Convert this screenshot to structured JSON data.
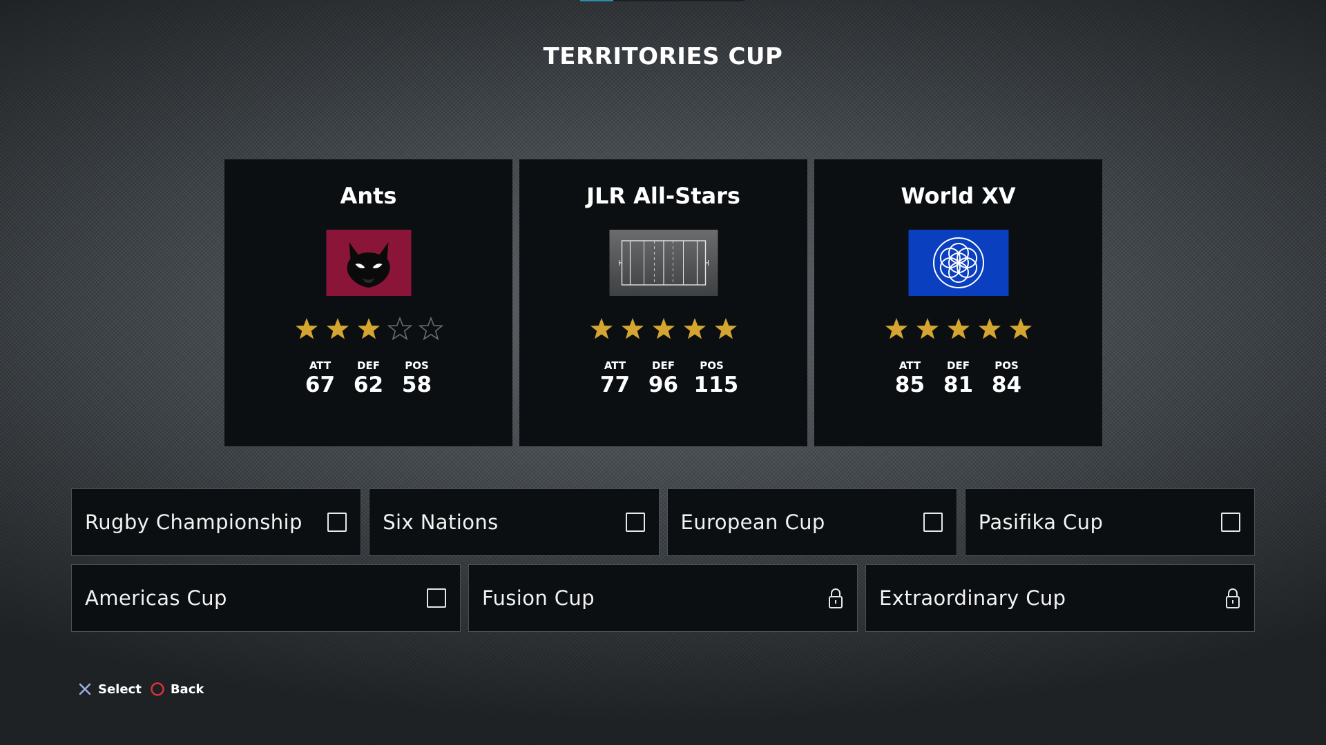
{
  "title": "TERRITORIES CUP",
  "colors": {
    "star_filled": "#d4a530",
    "star_empty": "#6b6f73",
    "card_bg": "#0b0f12",
    "accent": "#2a8fb0"
  },
  "teams": [
    {
      "name": "Ants",
      "badge_icon": "ant-head-icon",
      "badge_color": "#8b1538",
      "rating": 3,
      "max_rating": 5,
      "stats": [
        {
          "label": "ATT",
          "value": "67"
        },
        {
          "label": "DEF",
          "value": "62"
        },
        {
          "label": "POS",
          "value": "58"
        }
      ]
    },
    {
      "name": "JLR All-Stars",
      "badge_icon": "rugby-pitch-icon",
      "badge_color": "#4a4c4e",
      "rating": 5,
      "max_rating": 5,
      "stats": [
        {
          "label": "ATT",
          "value": "77"
        },
        {
          "label": "DEF",
          "value": "96"
        },
        {
          "label": "POS",
          "value": "115"
        }
      ]
    },
    {
      "name": "World XV",
      "badge_icon": "flower-of-life-icon",
      "badge_color": "#0a3fc0",
      "rating": 5,
      "max_rating": 5,
      "stats": [
        {
          "label": "ATT",
          "value": "85"
        },
        {
          "label": "DEF",
          "value": "81"
        },
        {
          "label": "POS",
          "value": "84"
        }
      ]
    }
  ],
  "competitions": [
    {
      "label": "Rugby Championship",
      "state": "unchecked"
    },
    {
      "label": "Six Nations",
      "state": "unchecked"
    },
    {
      "label": "European Cup",
      "state": "unchecked"
    },
    {
      "label": "Pasifika Cup",
      "state": "unchecked"
    },
    {
      "label": "Americas Cup",
      "state": "unchecked"
    },
    {
      "label": "Fusion Cup",
      "state": "locked"
    },
    {
      "label": "Extraordinary Cup",
      "state": "locked"
    }
  ],
  "prompts": [
    {
      "button": "cross-button-icon",
      "label": "Select"
    },
    {
      "button": "circle-button-icon",
      "label": "Back"
    }
  ]
}
